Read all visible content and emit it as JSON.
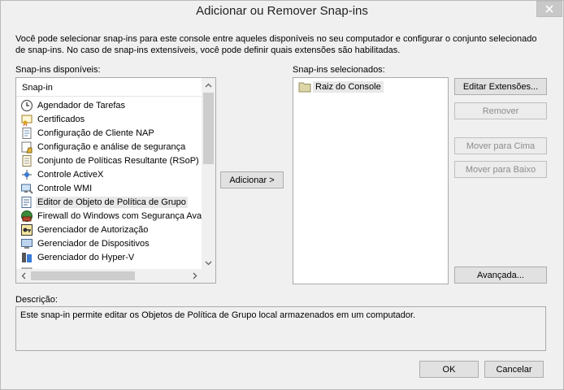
{
  "window": {
    "title": "Adicionar ou Remover Snap-ins"
  },
  "intro_text": "Você pode selecionar snap-ins para este console entre aqueles disponíveis no seu computador e configurar o conjunto selecionado de snap-ins. No caso de snap-ins extensíveis, você pode definir quais extensões são habilitadas.",
  "available": {
    "label": "Snap-ins disponíveis:",
    "column_header": "Snap-in",
    "items": [
      {
        "label": "Agendador de Tarefas",
        "icon": "clock-icon"
      },
      {
        "label": "Certificados",
        "icon": "certificate-icon"
      },
      {
        "label": "Configuração de Cliente NAP",
        "icon": "document-icon"
      },
      {
        "label": "Configuração e análise de segurança",
        "icon": "security-config-icon"
      },
      {
        "label": "Conjunto de Políticas Resultante (RSoP)",
        "icon": "rsop-icon"
      },
      {
        "label": "Controle ActiveX",
        "icon": "activex-icon"
      },
      {
        "label": "Controle WMI",
        "icon": "wmi-icon"
      },
      {
        "label": "Editor de Objeto de Política de Grupo",
        "icon": "gpo-editor-icon"
      },
      {
        "label": "Firewall do Windows com Segurança Avançada",
        "icon": "firewall-icon"
      },
      {
        "label": "Gerenciador de Autorização",
        "icon": "authorization-icon"
      },
      {
        "label": "Gerenciador de Dispositivos",
        "icon": "device-manager-icon"
      },
      {
        "label": "Gerenciador do Hyper-V",
        "icon": "hyperv-icon"
      }
    ],
    "selected_index": 7
  },
  "add_button": "Adicionar >",
  "selected": {
    "label": "Snap-ins selecionados:",
    "items": [
      {
        "label": "Raiz do Console",
        "icon": "folder-icon"
      }
    ]
  },
  "side_buttons": {
    "edit_extensions": "Editar Extensões...",
    "remove": "Remover",
    "move_up": "Mover para Cima",
    "move_down": "Mover para Baixo",
    "advanced": "Avançada..."
  },
  "description": {
    "label": "Descrição:",
    "text": "Este snap-in permite editar os Objetos de Política de Grupo local armazenados em um computador."
  },
  "footer": {
    "ok": "OK",
    "cancel": "Cancelar"
  }
}
